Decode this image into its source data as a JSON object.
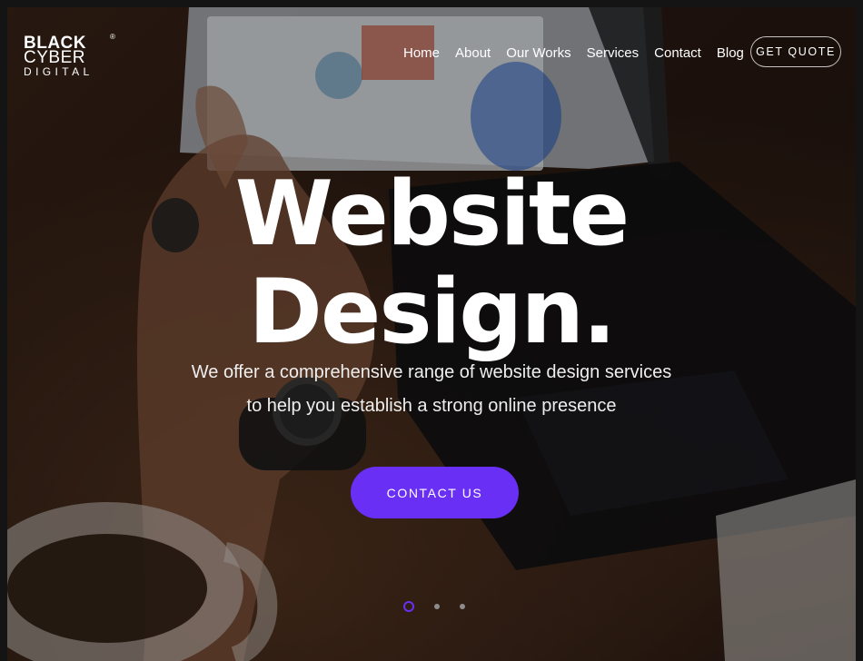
{
  "logo": {
    "line1": "BLACK",
    "line2": "CYBER",
    "line3": "DIGITAL",
    "registered": "®"
  },
  "nav": {
    "items": [
      {
        "label": "Home"
      },
      {
        "label": "About"
      },
      {
        "label": "Our Works"
      },
      {
        "label": "Services"
      },
      {
        "label": "Contact"
      },
      {
        "label": "Blog"
      }
    ],
    "quote_label": "GET QUOTE"
  },
  "hero": {
    "headline_line1": "Website",
    "headline_line2": "Design.",
    "subtitle_line1": "We offer a comprehensive range of website design services",
    "subtitle_line2": "to help you establish a strong online presence",
    "cta_label": "CONTACT US"
  },
  "slider": {
    "total_slides": 3,
    "active_slide": 1
  },
  "colors": {
    "accent": "#6a2ff5",
    "text": "#ffffff"
  }
}
